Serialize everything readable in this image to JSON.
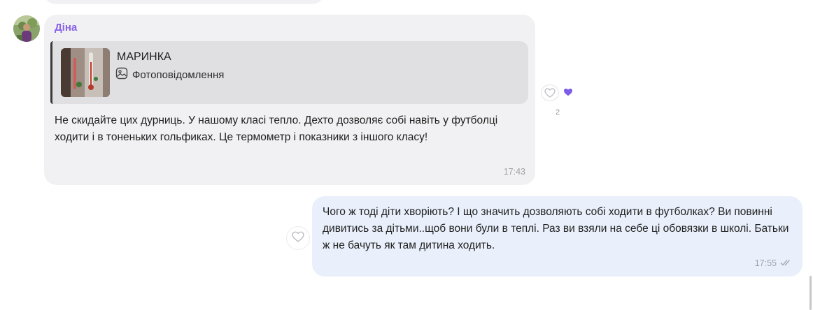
{
  "incoming": {
    "sender": "Діна",
    "reply": {
      "name": "МАРИНКА",
      "type_label": "Фотоповідомлення",
      "type_icon": "photo-icon"
    },
    "text": "Не скидайте цих дурниць. У нашому класі тепло. Дехто дозволяє собі навіть у футболці ходити і в тоненьких гольфиках. Це термометр  і показники з іншого класу!",
    "time": "17:43",
    "reactions": {
      "icons": [
        "heart-outline-icon",
        "heart-filled-icon"
      ],
      "count": "2",
      "heart_color": "#7c5ce8"
    }
  },
  "outgoing": {
    "text": "Чого ж тоді діти хворіють? І що значить дозволяють собі ходити в футболках? Ви повинні дивитись за дітьми..щоб вони були в теплі. Раз ви взяли на себе ці обовязки в школі. Батьки ж не бачуть як там дитина ходить.",
    "time": "17:55",
    "status_icon": "double-check-icon"
  },
  "colors": {
    "incoming_bubble": "#f1f1f3",
    "outgoing_bubble": "#e9f0fb",
    "sender_name": "#8a62e8"
  }
}
